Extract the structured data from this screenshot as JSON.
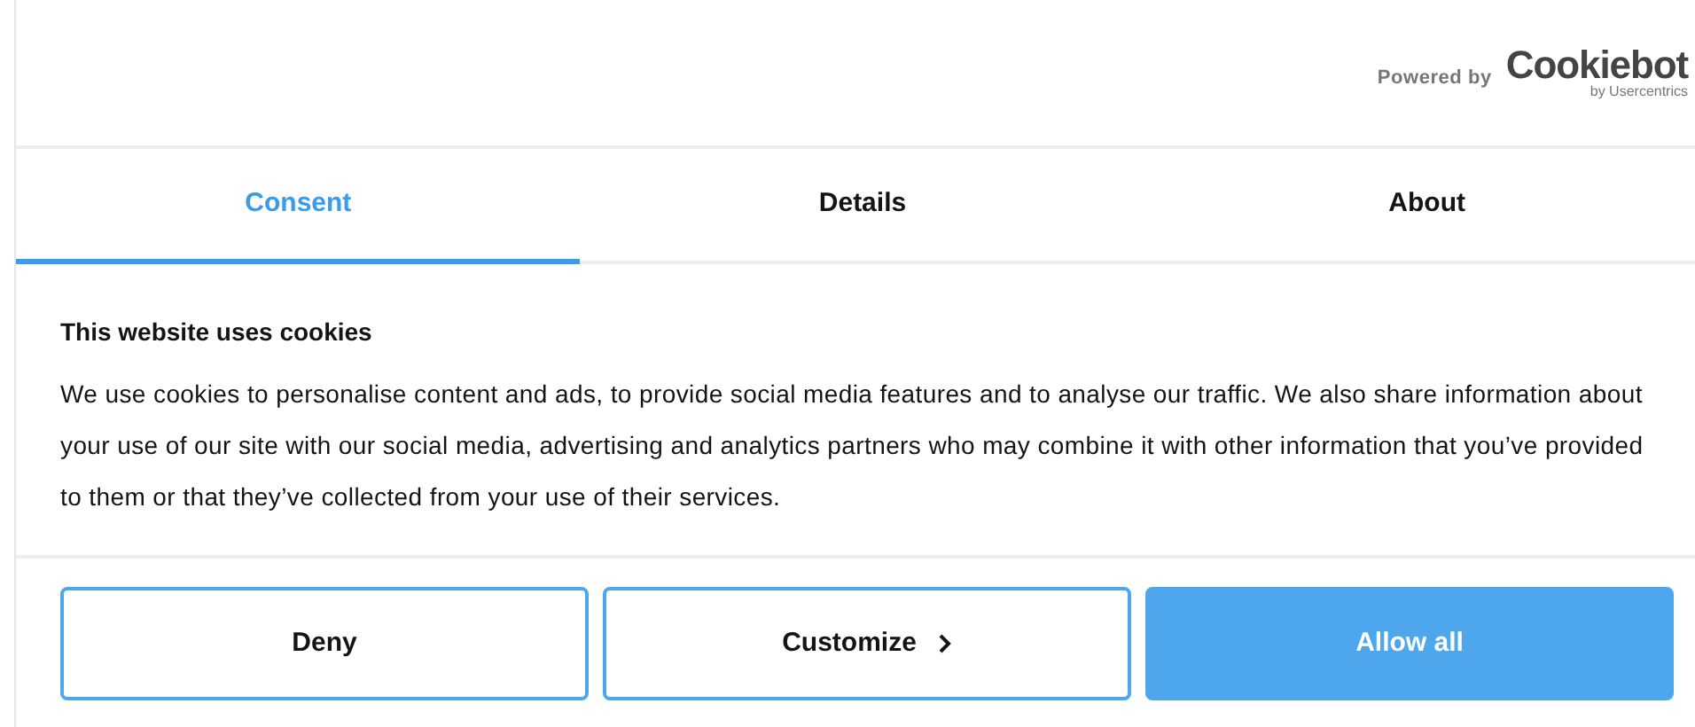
{
  "header": {
    "powered_by": "Powered by",
    "logo": {
      "name": "Cookiebot",
      "subtitle": "by Usercentrics"
    }
  },
  "tabs": [
    {
      "label": "Consent",
      "selected": true
    },
    {
      "label": "Details",
      "selected": false
    },
    {
      "label": "About",
      "selected": false
    }
  ],
  "content": {
    "title": "This website uses cookies",
    "body": "We use cookies to personalise content and ads, to provide social media features and to analyse our traffic. We also share information about your use of our site with our social media, advertising and analytics partners who may combine it with other information that you’ve provided to them or that they’ve collected from your use of their services."
  },
  "buttons": [
    {
      "label": "Deny",
      "kind": "outline"
    },
    {
      "label": "Customize",
      "kind": "outline-chevron"
    },
    {
      "label": "Allow all",
      "kind": "primary"
    }
  ]
}
